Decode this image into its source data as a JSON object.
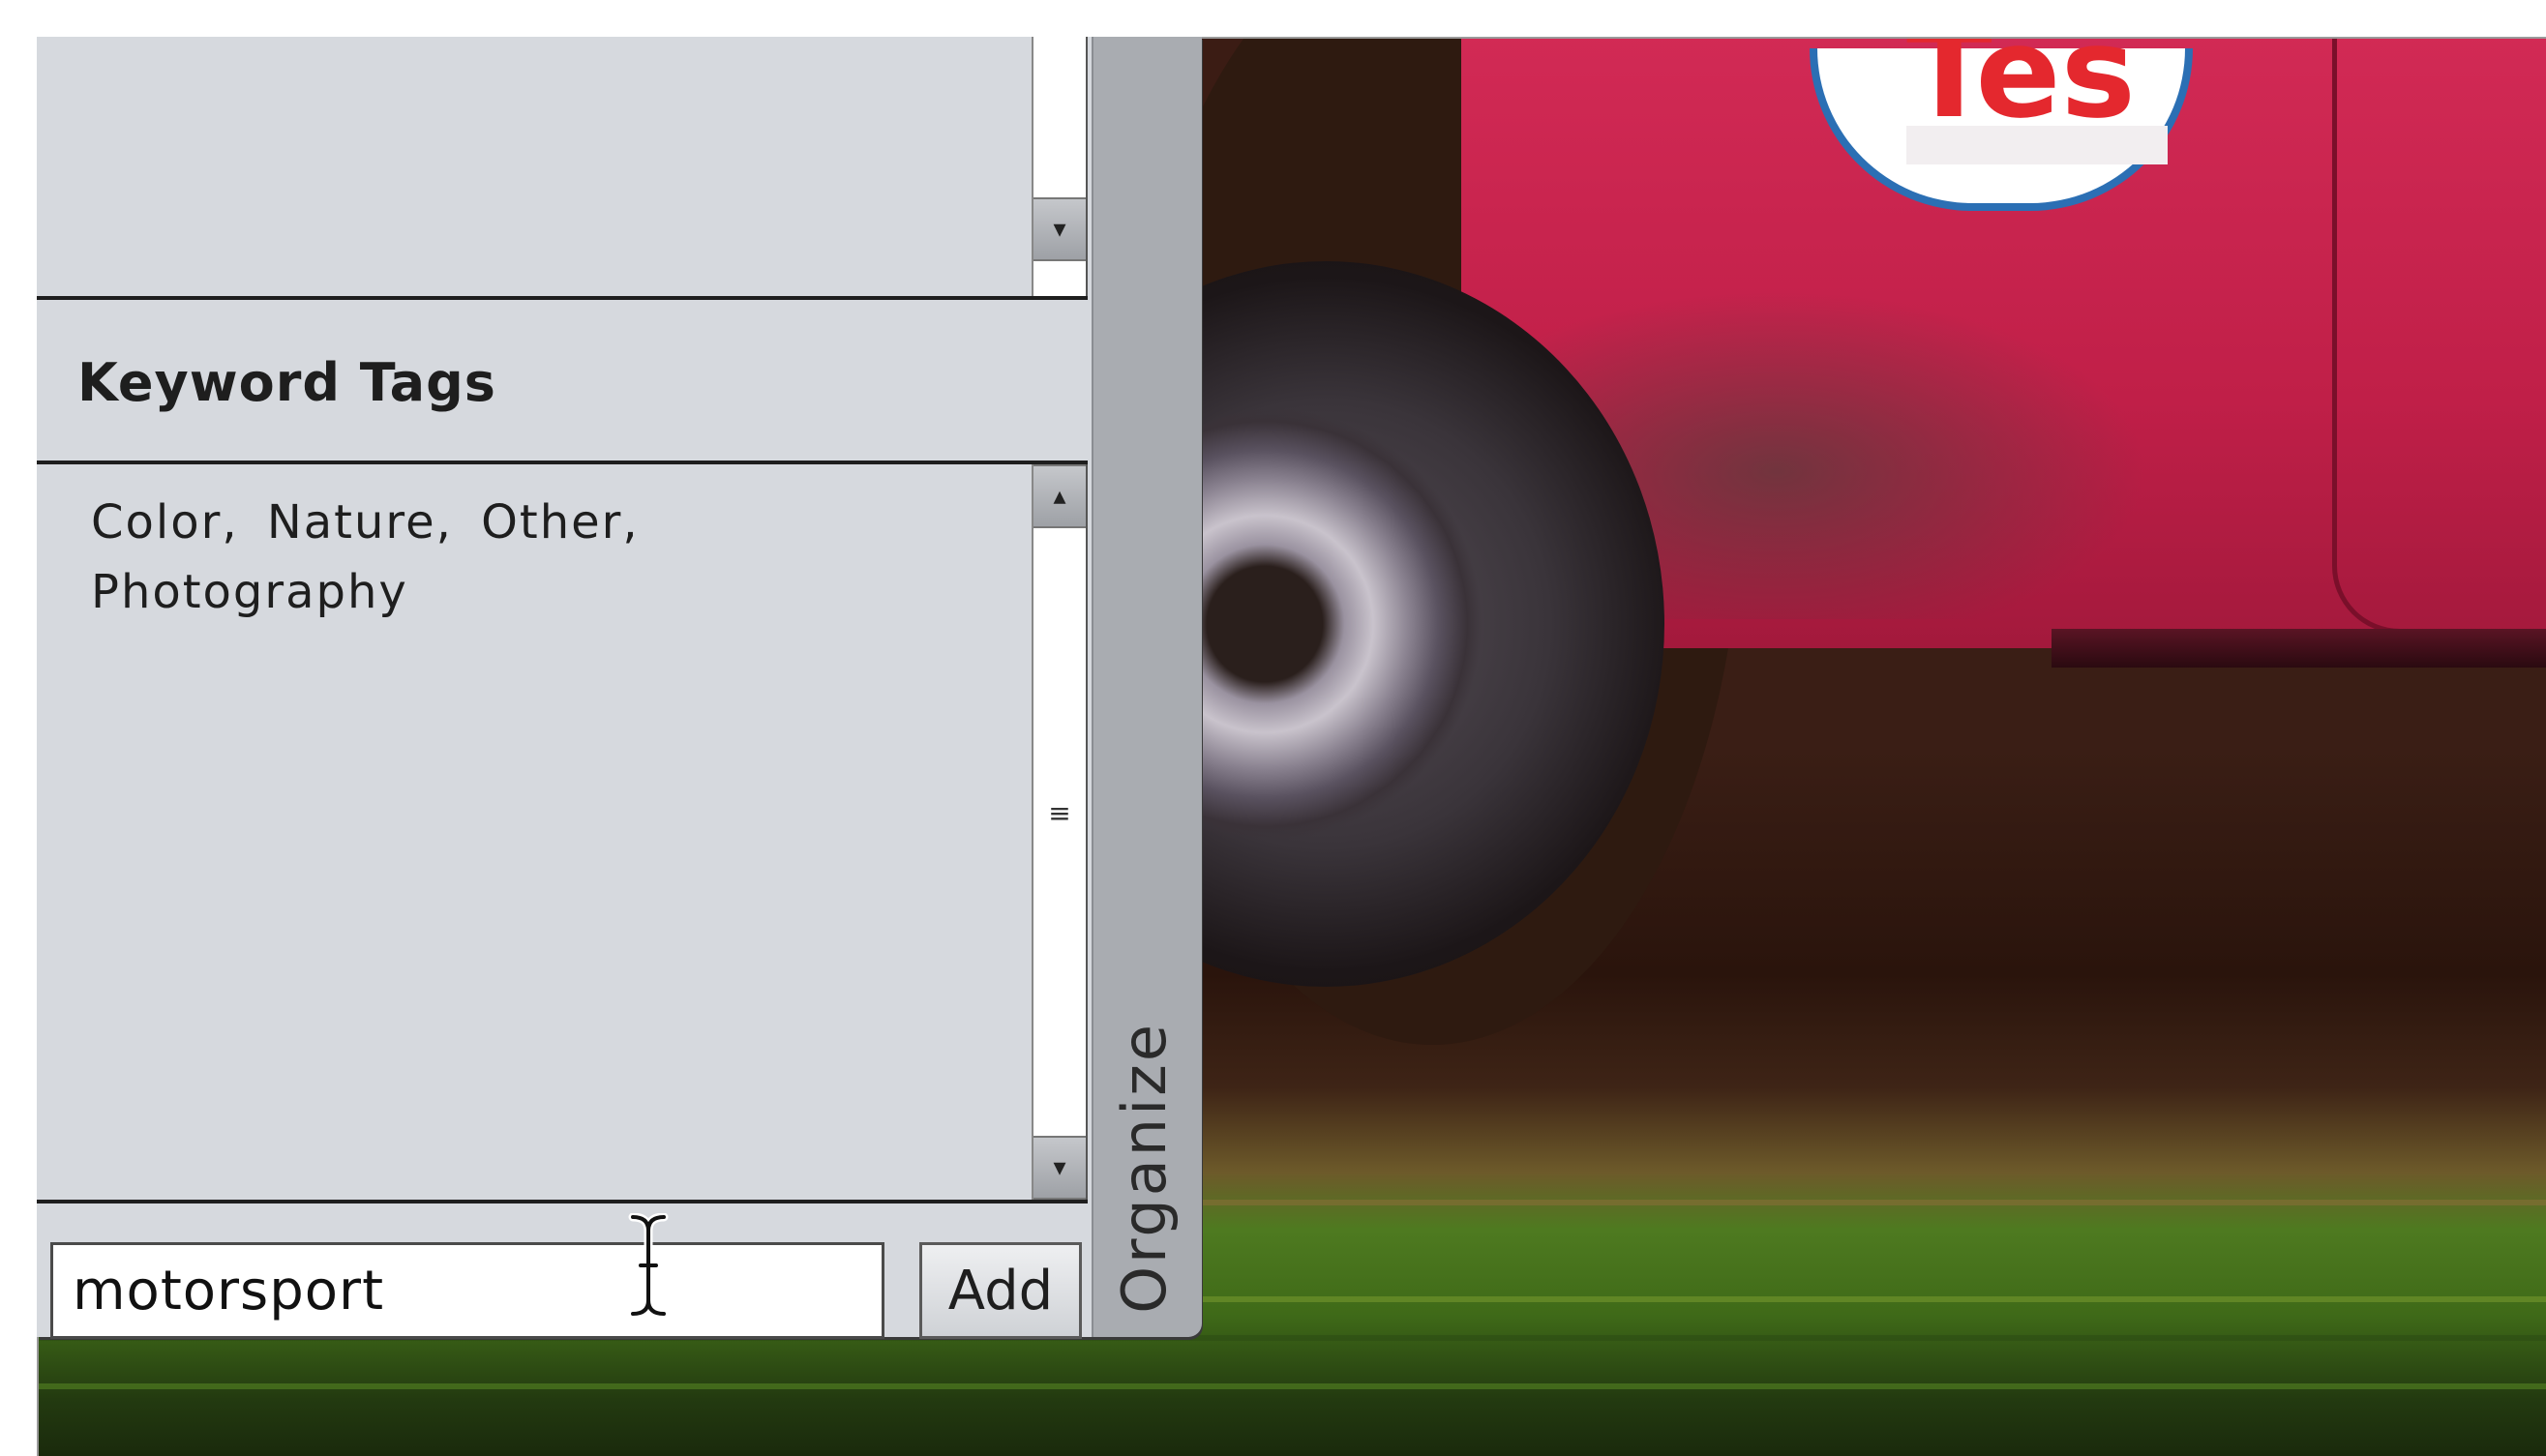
{
  "keyword_tags": {
    "title": "Keyword Tags",
    "tags_text": "Color, Nature, Other, Photography"
  },
  "add_keyword": {
    "input_value": "motorsport",
    "button_label": "Add"
  },
  "side_tab": {
    "label": "Organize"
  },
  "photo": {
    "sticker_text": "Tes"
  },
  "icons": [
    "scroll-up-arrow-icon",
    "scroll-down-arrow-icon",
    "scroll-grip-icon",
    "text-cursor-icon"
  ],
  "colors": {
    "panel_background": "#d6d9de",
    "tab_background": "#a9acb1",
    "car_red": "#c01f48"
  }
}
